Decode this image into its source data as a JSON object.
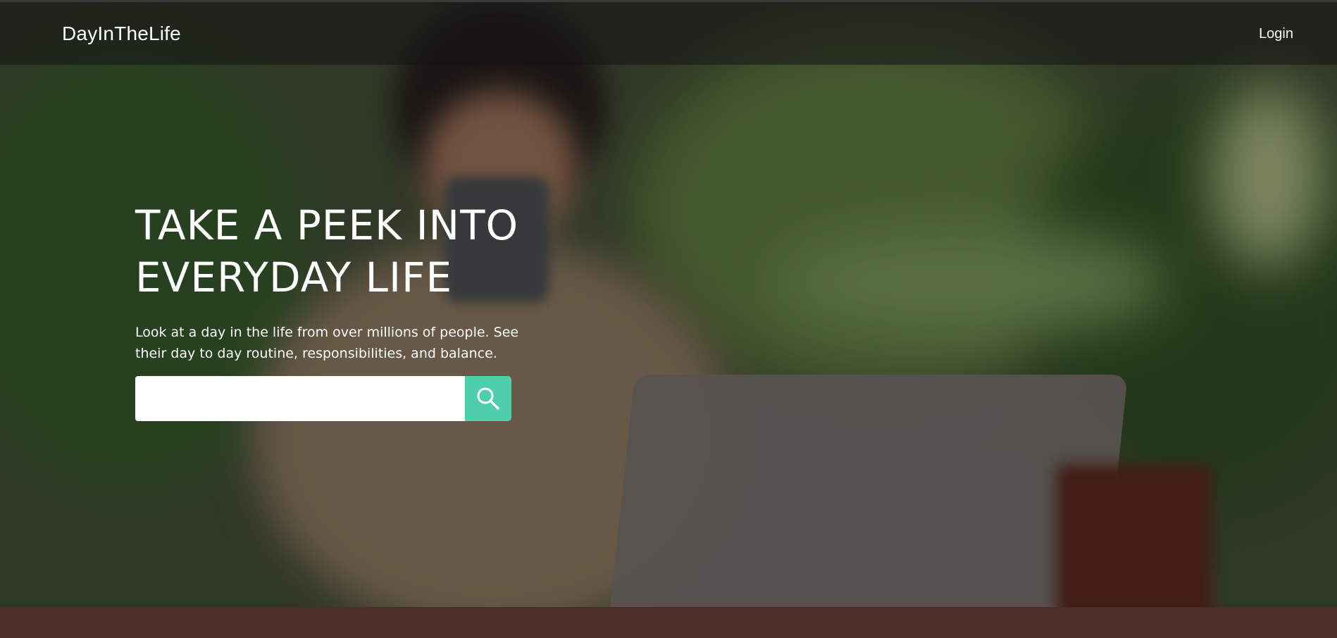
{
  "nav": {
    "brand": "DayInTheLife",
    "login_label": "Login"
  },
  "hero": {
    "headline": "TAKE A PEEK INTO EVERYDAY LIFE",
    "subtext": "Look at a day in the life from over millions of people. See their day to day routine, responsibilities, and balance."
  },
  "search": {
    "value": "",
    "placeholder": "",
    "button_icon": "search-icon"
  },
  "colors": {
    "accent": "#4ecfac",
    "nav_bg": "#1e1e1e",
    "text": "#ffffff"
  }
}
